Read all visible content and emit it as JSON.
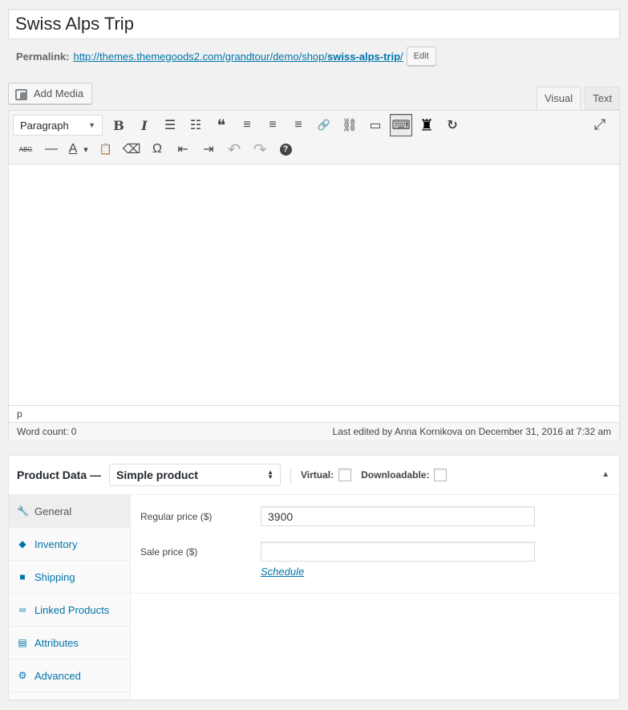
{
  "post": {
    "title": "Swiss Alps Trip",
    "permalink_label": "Permalink:",
    "permalink_base": "http://themes.themegoods2.com/grandtour/demo/shop/",
    "permalink_slug": "swiss-alps-trip",
    "permalink_trailing": "/",
    "edit_label": "Edit"
  },
  "media": {
    "add_media_label": "Add Media"
  },
  "editor": {
    "tabs": [
      {
        "label": "Visual"
      },
      {
        "label": "Text"
      }
    ],
    "active_tab": "Visual",
    "format_select": "Paragraph",
    "path": "p",
    "word_count": "Word count: 0",
    "last_edited": "Last edited by Anna Kornikova on December 31, 2016 at 7:32 am",
    "toolbar_row1": [
      {
        "icon": "bold-icon",
        "glyph": "B"
      },
      {
        "icon": "italic-icon",
        "glyph": "I"
      },
      {
        "icon": "bulleted-list-icon",
        "glyph": "☰"
      },
      {
        "icon": "numbered-list-icon",
        "glyph": "☷"
      },
      {
        "icon": "blockquote-icon",
        "glyph": "❝"
      },
      {
        "icon": "align-left-icon",
        "glyph": "≡"
      },
      {
        "icon": "align-center-icon",
        "glyph": "≡"
      },
      {
        "icon": "align-right-icon",
        "glyph": "≡"
      },
      {
        "icon": "link-icon",
        "glyph": "🔗"
      },
      {
        "icon": "unlink-icon",
        "glyph": "⛓"
      },
      {
        "icon": "read-more-icon",
        "glyph": "▭"
      },
      {
        "icon": "toolbar-toggle-icon",
        "glyph": "⌨"
      },
      {
        "icon": "shortcode-icon",
        "glyph": "♜"
      },
      {
        "icon": "refresh-icon",
        "glyph": "↻"
      }
    ],
    "toolbar_row2": [
      {
        "icon": "strikethrough-icon",
        "glyph": "ABC"
      },
      {
        "icon": "horizontal-line-icon",
        "glyph": "—"
      },
      {
        "icon": "text-color-icon",
        "glyph": "A"
      },
      {
        "icon": "text-color-dropdown-icon",
        "glyph": "▾"
      },
      {
        "icon": "paste-text-icon",
        "glyph": "📋"
      },
      {
        "icon": "clear-formatting-icon",
        "glyph": "⌫"
      },
      {
        "icon": "special-character-icon",
        "glyph": "Ω"
      },
      {
        "icon": "outdent-icon",
        "glyph": "⇤"
      },
      {
        "icon": "indent-icon",
        "glyph": "⇥"
      },
      {
        "icon": "undo-icon",
        "glyph": "↶"
      },
      {
        "icon": "redo-icon",
        "glyph": "↷"
      },
      {
        "icon": "help-icon",
        "glyph": "?"
      }
    ],
    "fullscreen_glyph": "⤢"
  },
  "product_data": {
    "title": "Product Data —",
    "type_select": "Simple product",
    "virtual_label": "Virtual:",
    "downloadable_label": "Downloadable:",
    "collapse_glyph": "▲",
    "nav": [
      {
        "label": "General",
        "icon": "wrench-icon",
        "glyph": "🔧",
        "active": true
      },
      {
        "label": "Inventory",
        "icon": "tag-icon",
        "glyph": "◆",
        "active": false
      },
      {
        "label": "Shipping",
        "icon": "truck-icon",
        "glyph": "■",
        "active": false
      },
      {
        "label": "Linked Products",
        "icon": "link-icon",
        "glyph": "∞",
        "active": false
      },
      {
        "label": "Attributes",
        "icon": "list-icon",
        "glyph": "▤",
        "active": false
      },
      {
        "label": "Advanced",
        "icon": "gear-icon",
        "glyph": "⚙",
        "active": false
      }
    ],
    "regular_price_label": "Regular price ($)",
    "regular_price_value": "3900",
    "sale_price_label": "Sale price ($)",
    "sale_price_value": "",
    "schedule_label": "Schedule"
  },
  "colors": {
    "link": "#0073aa",
    "background": "#f1f1f1"
  }
}
